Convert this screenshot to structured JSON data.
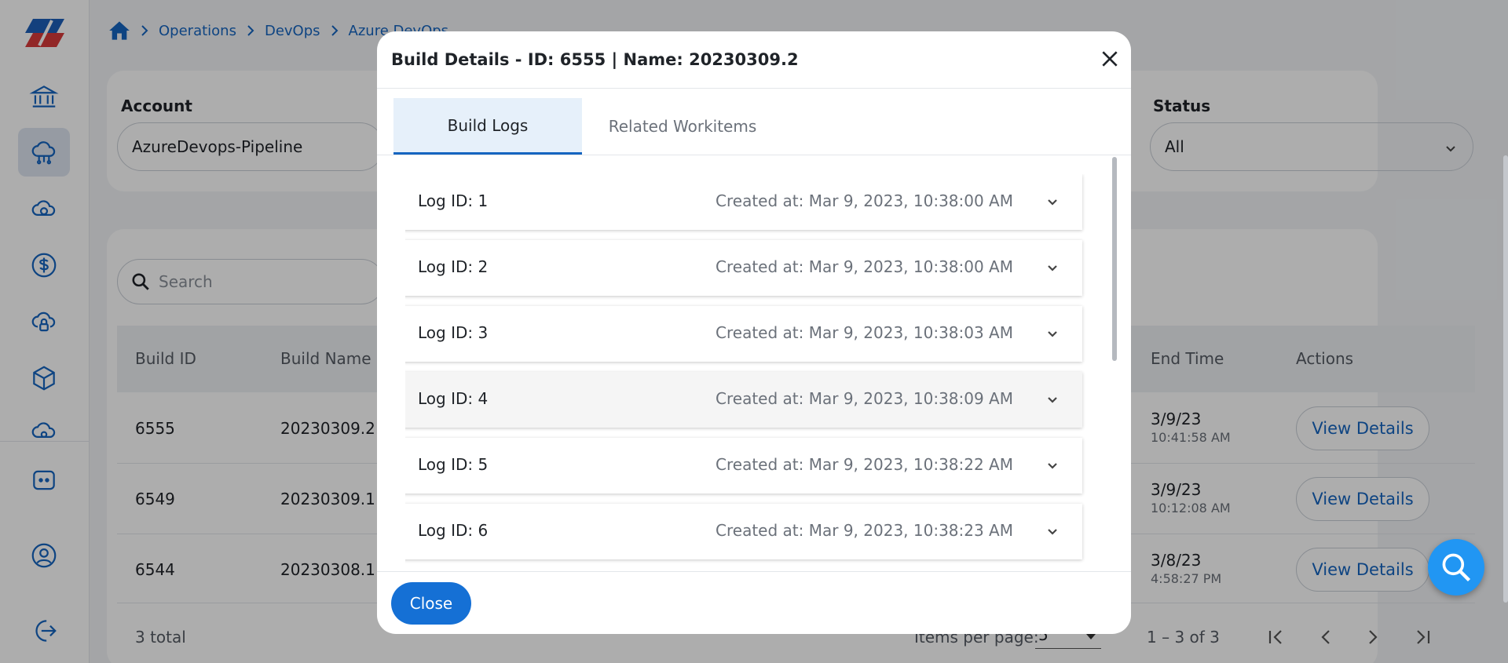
{
  "breadcrumb": {
    "items": [
      "Operations",
      "DevOps",
      "Azure DevOps"
    ]
  },
  "filters": {
    "account_label": "Account",
    "account_value": "AzureDevops-Pipeline",
    "status_label": "Status",
    "status_value": "All"
  },
  "table": {
    "search_placeholder": "Search",
    "headers": {
      "build_id": "Build ID",
      "build_name": "Build Name",
      "end_time": "End Time",
      "actions": "Actions"
    },
    "rows": [
      {
        "build_id": "6555",
        "build_name": "20230309.2",
        "end_date": "3/9/23",
        "end_time": "10:41:58 AM",
        "action": "View Details"
      },
      {
        "build_id": "6549",
        "build_name": "20230309.1",
        "end_date": "3/9/23",
        "end_time": "10:12:08 AM",
        "action": "View Details"
      },
      {
        "build_id": "6544",
        "build_name": "20230308.1",
        "end_date": "3/8/23",
        "end_time": "4:58:27 PM",
        "action": "View Details"
      }
    ],
    "total": "3 total",
    "items_per_page_label": "Items per page:",
    "items_per_page_value": "5",
    "range": "1 – 3 of 3"
  },
  "modal": {
    "title": "Build Details - ID: 6555 | Name: 20230309.2",
    "tabs": {
      "build_logs": "Build Logs",
      "related_workitems": "Related Workitems"
    },
    "logs": [
      {
        "id": "Log ID: 1",
        "created": "Created at: Mar 9, 2023, 10:38:00 AM"
      },
      {
        "id": "Log ID: 2",
        "created": "Created at: Mar 9, 2023, 10:38:00 AM"
      },
      {
        "id": "Log ID: 3",
        "created": "Created at: Mar 9, 2023, 10:38:03 AM"
      },
      {
        "id": "Log ID: 4",
        "created": "Created at: Mar 9, 2023, 10:38:09 AM"
      },
      {
        "id": "Log ID: 5",
        "created": "Created at: Mar 9, 2023, 10:38:22 AM"
      },
      {
        "id": "Log ID: 6",
        "created": "Created at: Mar 9, 2023, 10:38:23 AM"
      }
    ],
    "close_label": "Close"
  },
  "colors": {
    "accent": "#1570d5",
    "link": "#1565c0",
    "overlay": "rgba(0,0,0,0.32)"
  }
}
